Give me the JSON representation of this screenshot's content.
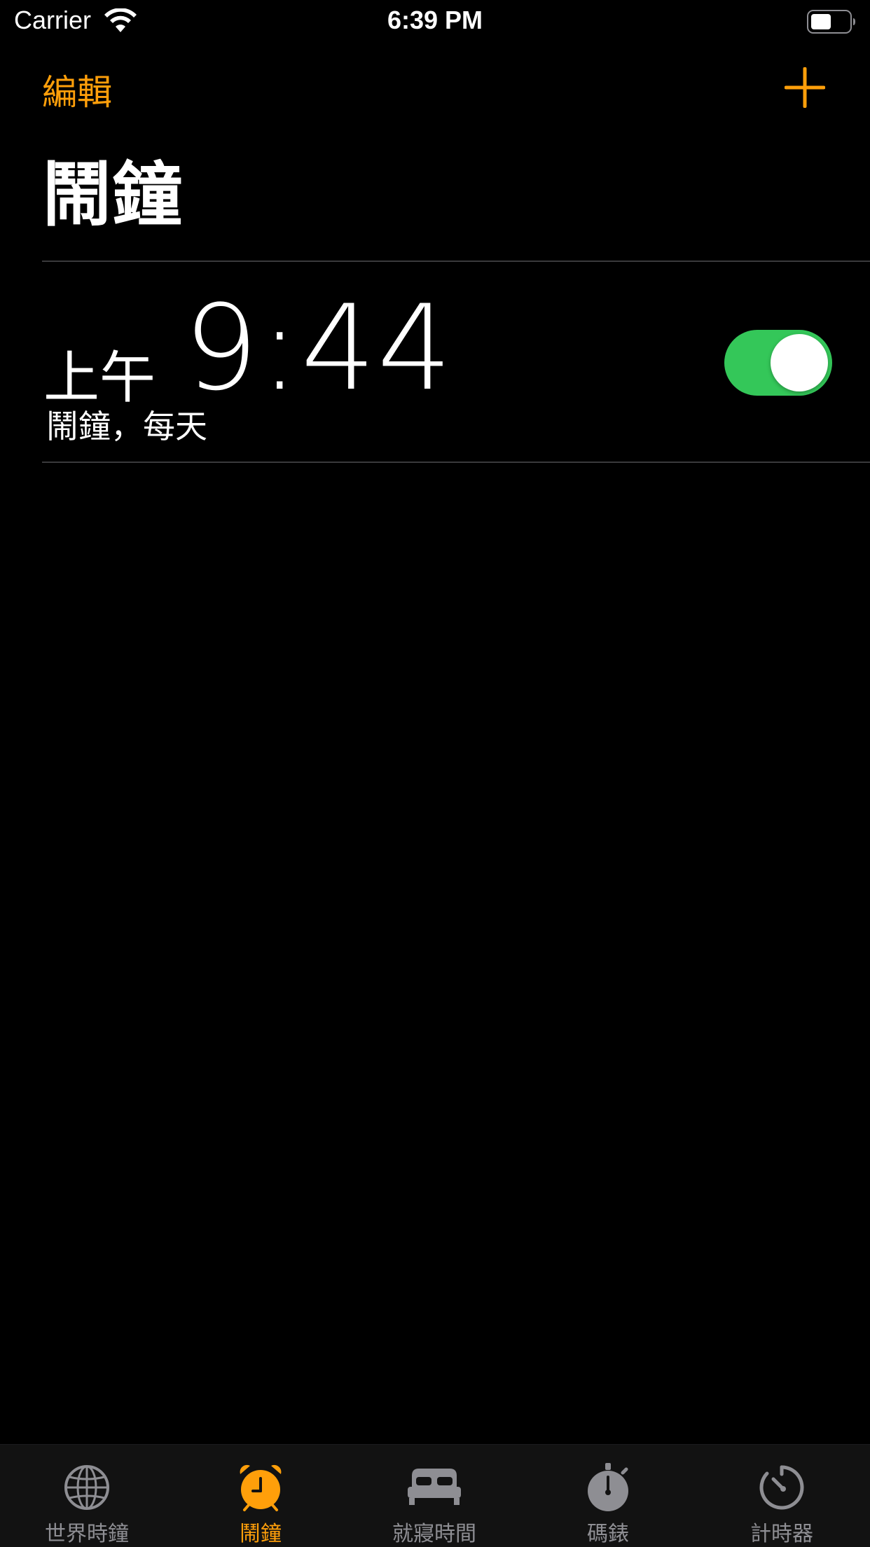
{
  "status_bar": {
    "carrier": "Carrier",
    "time": "6:39 PM"
  },
  "nav": {
    "edit_label": "編輯",
    "add_icon": "plus-icon"
  },
  "title": "鬧鐘",
  "alarms": [
    {
      "period": "上午",
      "time": "9:44",
      "label": "鬧鐘，每天",
      "enabled": true
    }
  ],
  "tab_bar": {
    "tabs": [
      {
        "label": "世界時鐘",
        "icon": "globe-icon",
        "active": false
      },
      {
        "label": "鬧鐘",
        "icon": "alarm-clock-icon",
        "active": true
      },
      {
        "label": "就寢時間",
        "icon": "bed-icon",
        "active": false
      },
      {
        "label": "碼錶",
        "icon": "stopwatch-icon",
        "active": false
      },
      {
        "label": "計時器",
        "icon": "timer-icon",
        "active": false
      }
    ]
  },
  "colors": {
    "accent": "#ff9f0a",
    "toggle_on": "#34c759",
    "background": "#000000",
    "tab_inactive": "#8e8e93"
  }
}
